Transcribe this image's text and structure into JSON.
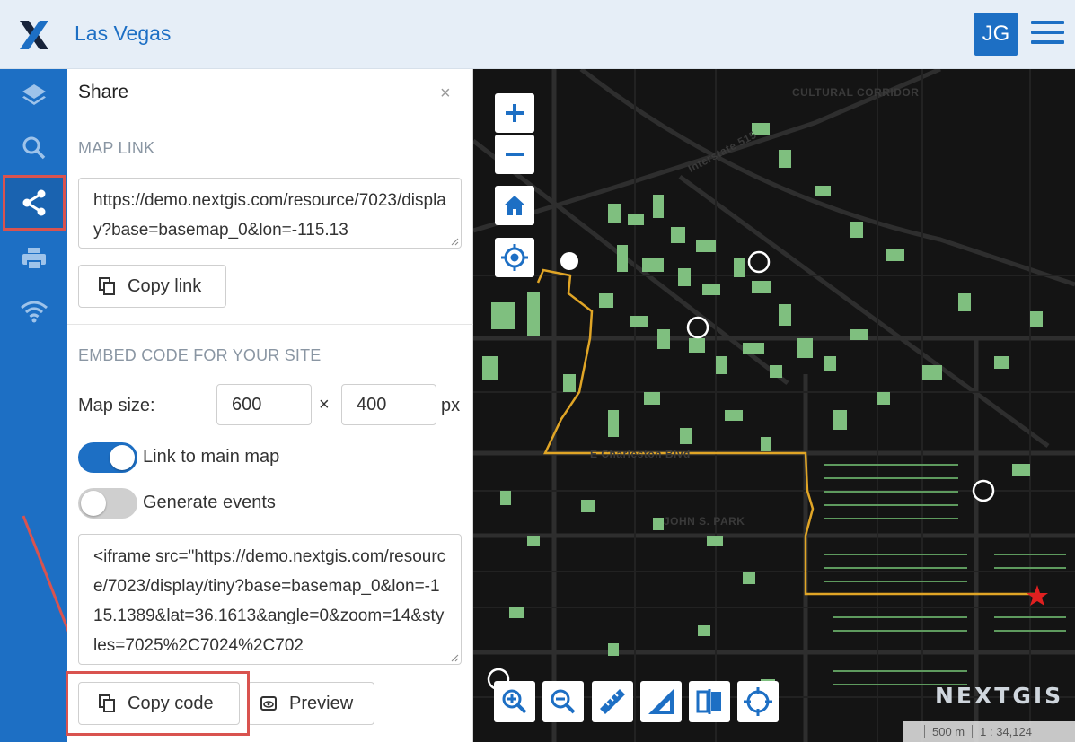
{
  "header": {
    "title": "Las Vegas",
    "avatar_initials": "JG",
    "brand_color": "#1d6fc4"
  },
  "rail": {
    "items": [
      {
        "name": "layers",
        "icon": "layers-icon",
        "active": false
      },
      {
        "name": "search",
        "icon": "search-icon",
        "active": false
      },
      {
        "name": "share",
        "icon": "share-icon",
        "active": true
      },
      {
        "name": "print",
        "icon": "print-icon",
        "active": false
      },
      {
        "name": "wifi",
        "icon": "wifi-icon",
        "active": false
      }
    ]
  },
  "share_panel": {
    "title": "Share",
    "close_symbol": "×",
    "map_link_label": "MAP LINK",
    "map_link_value": "https://demo.nextgis.com/resource/7023/display?base=basemap_0&lon=-115.13",
    "copy_link_label": "Copy link",
    "embed_label": "EMBED CODE FOR YOUR SITE",
    "map_size_label": "Map size:",
    "width_value": "600",
    "times_symbol": "×",
    "height_value": "400",
    "unit_label": "px",
    "link_main_map_label": "Link to main map",
    "link_main_map_on": true,
    "generate_events_label": "Generate events",
    "generate_events_on": false,
    "embed_code": "<iframe src=\"https://demo.nextgis.com/resource/7023/display/tiny?base=basemap_0&lon=-115.1389&lat=36.1613&angle=0&zoom=14&styles=7025%2C7024%2C702",
    "copy_code_label": "Copy code",
    "preview_label": "Preview"
  },
  "map": {
    "labels": {
      "cultural_corridor": "CULTURAL CORRIDOR",
      "interstate_515": "Interstate 515",
      "john_s_park": "JOHN S. PARK",
      "charleston_blvd": "E Charleston Blvd"
    },
    "brand": "NEXTGIS",
    "scale_text": "500 m",
    "scale_ratio": "1 : 34,124",
    "accent_route_color": "#e0a526",
    "building_color": "#7fbf7f"
  }
}
